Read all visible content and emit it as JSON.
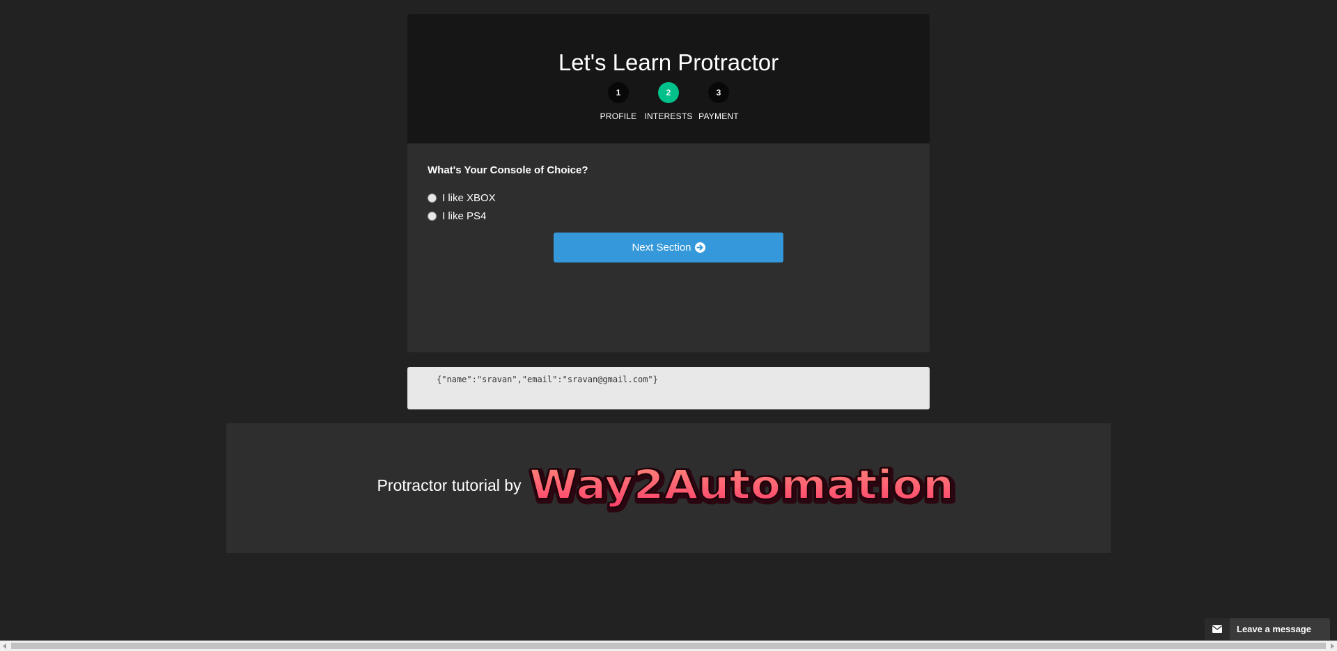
{
  "form": {
    "title": "Let's Learn Protractor",
    "steps": [
      {
        "number": "1",
        "label": "PROFILE",
        "active": false
      },
      {
        "number": "2",
        "label": "INTERESTS",
        "active": true
      },
      {
        "number": "3",
        "label": "PAYMENT",
        "active": false
      }
    ],
    "question": "What's Your Console of Choice?",
    "options": [
      {
        "label": "I like XBOX",
        "checked": false
      },
      {
        "label": "I like PS4",
        "checked": false
      }
    ],
    "next_button": {
      "label": "Next Section",
      "icon": "arrow-circle-right-icon"
    }
  },
  "json_preview": "{\"name\":\"sravan\",\"email\":\"sravan@gmail.com\"}",
  "footer": {
    "text": "Protractor tutorial by",
    "logo_text": "Way2Automation"
  },
  "chat": {
    "label": "Leave a message",
    "icon": "envelope-icon"
  },
  "colors": {
    "page_bg": "#222222",
    "header_bg": "#161616",
    "panel_bg": "#2e2e2e",
    "active_step": "#00c18a",
    "button": "#3498db",
    "logo_fill_top": "#ff8a7a",
    "logo_fill_bottom": "#ff3f6c"
  }
}
